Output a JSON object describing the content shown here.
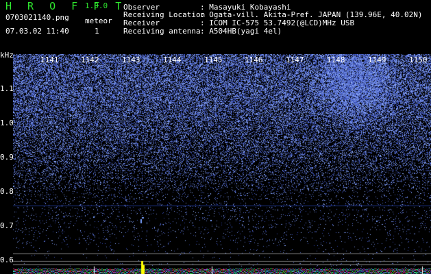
{
  "header": {
    "app_name": "H R O F F T",
    "version": "1.0.0",
    "filename": "0703021140.png",
    "timestamp": "07.03.02 11:40",
    "meteor_label": "meteor",
    "meteor_count": "1"
  },
  "info": [
    {
      "label": "Observer",
      "value": ": Masayuki Kobayashi"
    },
    {
      "label": "Receiving Location",
      "value": ": Ogata-vill. Akita-Pref. JAPAN (139.96E, 40.02N)"
    },
    {
      "label": "Receiver",
      "value": ": ICOM IC-575 53.7492(@LCD)MHz USB"
    },
    {
      "label": "Receiving antenna",
      "value": ": A504HB(yagi 4el)"
    }
  ],
  "spectrogram": {
    "y_unit": "kHz",
    "y_ticks": [
      "1.1",
      "1.0",
      "0.9",
      "0.8",
      "0.7",
      "0.6"
    ],
    "x_ticks": [
      "1141",
      "1142",
      "1143",
      "1144",
      "1145",
      "1146",
      "1147",
      "1148",
      "1149",
      "1150"
    ],
    "colors": {
      "background": "#000000",
      "noise": "#3a5cd6",
      "bright": "#9fb6ff"
    }
  }
}
